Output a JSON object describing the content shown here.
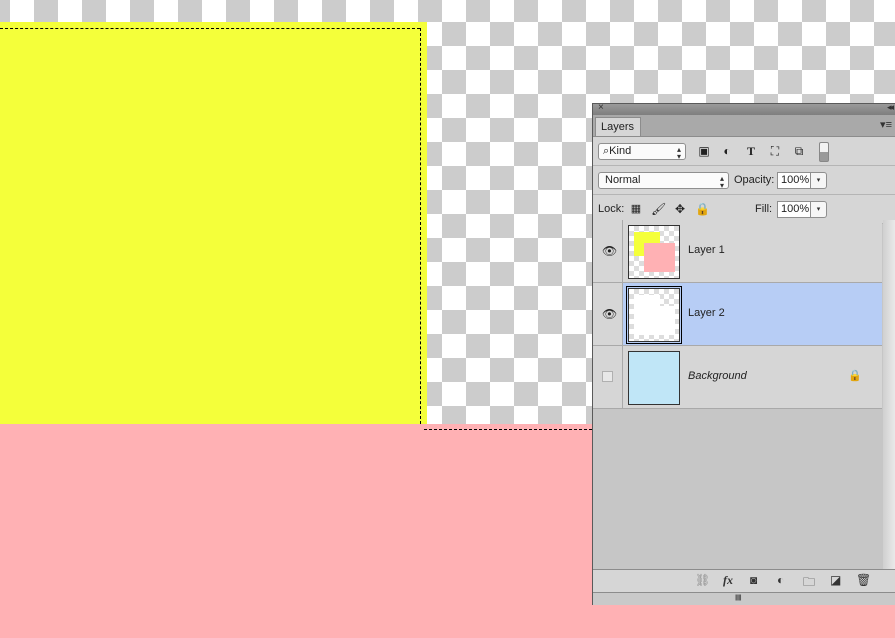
{
  "canvas": {
    "colors": {
      "yellow": "#f4ff3a",
      "pink": "#ffb1b4",
      "checker_dark": "#cccccc",
      "checker_light": "#ffffff"
    }
  },
  "panel": {
    "tab_label": "Layers",
    "close_glyph": "×",
    "collapse_glyph": "◂◂",
    "menu_glyph": "▾≡",
    "filter": {
      "value": "Kind",
      "icons": [
        "image-filter-icon",
        "adjustment-filter-icon",
        "type-filter-icon",
        "shape-filter-icon",
        "smart-object-filter-icon"
      ]
    },
    "blend_mode": "Normal",
    "opacity_label": "Opacity:",
    "opacity_value": "100%",
    "lock_label": "Lock:",
    "fill_label": "Fill:",
    "fill_value": "100%",
    "layers": [
      {
        "name": "Layer 1",
        "visible": true,
        "selected": false,
        "locked": false
      },
      {
        "name": "Layer 2",
        "visible": true,
        "selected": true,
        "locked": false
      },
      {
        "name": "Background",
        "visible": false,
        "selected": false,
        "locked": true
      }
    ],
    "colors": {
      "selected_row": "#b7cdf5",
      "background_thumb": "#c0e6f7"
    }
  }
}
